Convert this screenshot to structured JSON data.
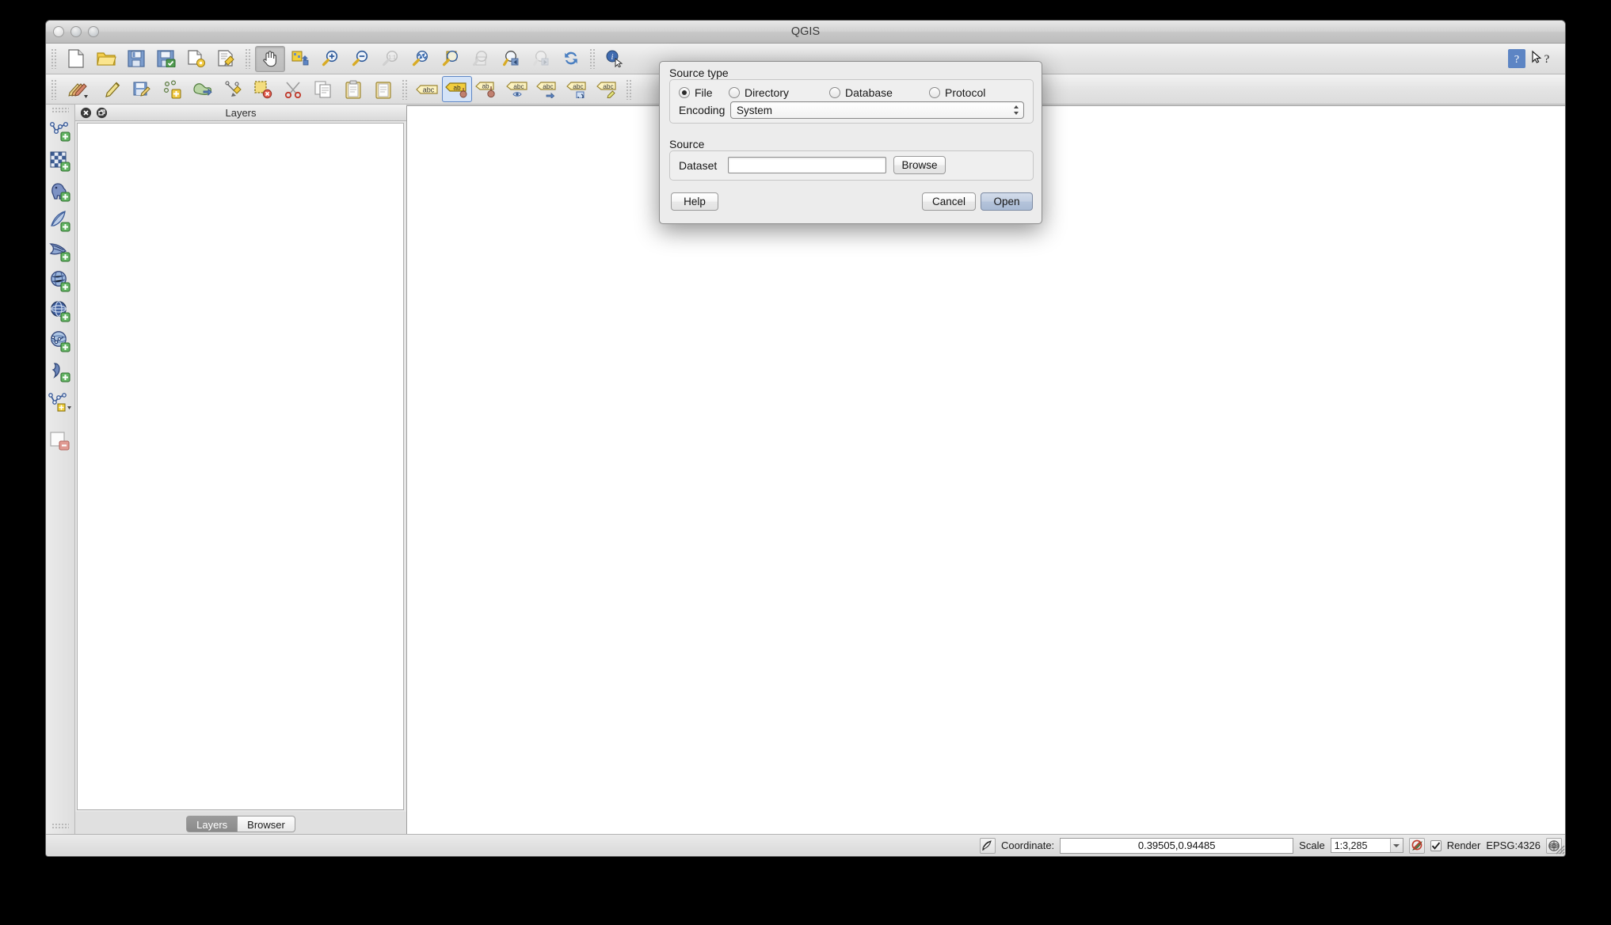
{
  "window": {
    "title": "QGIS",
    "controls": [
      "close-button",
      "minimize-button",
      "zoom-button"
    ]
  },
  "toolbar_file": {
    "icons": [
      {
        "name": "new-project-icon",
        "tip": "New Project"
      },
      {
        "name": "open-project-icon",
        "tip": "Open Project"
      },
      {
        "name": "save-project-icon",
        "tip": "Save Project"
      },
      {
        "name": "save-project-as-icon",
        "tip": "Save Project As"
      },
      {
        "name": "new-print-composer-icon",
        "tip": "New Print Composer"
      },
      {
        "name": "composer-manager-icon",
        "tip": "Composer Manager"
      }
    ]
  },
  "toolbar_navigation": {
    "icons": [
      {
        "name": "pan-map-icon",
        "tip": "Pan Map",
        "active": true
      },
      {
        "name": "pan-to-selection-icon",
        "tip": "Pan Map to Selection"
      },
      {
        "name": "zoom-in-icon",
        "tip": "Zoom In"
      },
      {
        "name": "zoom-out-icon",
        "tip": "Zoom Out"
      },
      {
        "name": "zoom-native-icon",
        "tip": "Zoom to Native Resolution",
        "disabled": true
      },
      {
        "name": "zoom-full-icon",
        "tip": "Zoom Full"
      },
      {
        "name": "zoom-to-selection-icon",
        "tip": "Zoom to Selection"
      },
      {
        "name": "zoom-to-layer-icon",
        "tip": "Zoom to Layer",
        "disabled": true
      },
      {
        "name": "zoom-last-icon",
        "tip": "Zoom Last"
      },
      {
        "name": "zoom-next-icon",
        "tip": "Zoom Next",
        "disabled": true
      },
      {
        "name": "refresh-icon",
        "tip": "Refresh"
      },
      {
        "name": "identify-features-icon",
        "tip": "Identify Features"
      }
    ]
  },
  "toolbar_help": {
    "icons": [
      {
        "name": "help-contents-icon",
        "tip": "Help Contents"
      },
      {
        "name": "whats-this-icon",
        "tip": "What's This?"
      }
    ]
  },
  "toolbar_digitizing": {
    "icons": [
      {
        "name": "current-edits-icon",
        "tip": "Current Edits"
      },
      {
        "name": "toggle-editing-icon",
        "tip": "Toggle Editing"
      },
      {
        "name": "save-layer-edits-icon",
        "tip": "Save Layer Edits"
      },
      {
        "name": "add-feature-icon",
        "tip": "Add Feature"
      },
      {
        "name": "move-feature-icon",
        "tip": "Move Feature"
      },
      {
        "name": "node-tool-icon",
        "tip": "Node Tool"
      },
      {
        "name": "delete-selected-icon",
        "tip": "Delete Selected"
      },
      {
        "name": "cut-features-icon",
        "tip": "Cut Features"
      },
      {
        "name": "copy-features-icon",
        "tip": "Copy Features"
      },
      {
        "name": "paste-features-icon",
        "tip": "Paste Features"
      }
    ]
  },
  "toolbar_label": {
    "icons": [
      {
        "name": "layer-labeling-options-icon",
        "tip": "Layer Labeling Options"
      },
      {
        "name": "highlight-pinned-labels-icon",
        "tip": "Highlight Pinned Labels",
        "selected": true
      },
      {
        "name": "pin-labels-icon",
        "tip": "Pin/Unpin Labels"
      },
      {
        "name": "show-hide-labels-icon",
        "tip": "Show/Hide Labels"
      },
      {
        "name": "move-label-icon",
        "tip": "Move Label"
      },
      {
        "name": "rotate-label-icon",
        "tip": "Rotate Label"
      },
      {
        "name": "change-label-icon",
        "tip": "Change Label"
      }
    ],
    "glyph": "abc"
  },
  "left_rail": {
    "items": [
      {
        "name": "add-vector-layer-icon",
        "tip": "Add Vector Layer"
      },
      {
        "name": "add-raster-layer-icon",
        "tip": "Add Raster Layer"
      },
      {
        "name": "add-postgis-layer-icon",
        "tip": "Add PostGIS Layer"
      },
      {
        "name": "add-spatialite-layer-icon",
        "tip": "Add SpatiaLite Layer"
      },
      {
        "name": "add-mssql-layer-icon",
        "tip": "Add MSSQL Spatial Layer"
      },
      {
        "name": "add-wcs-layer-icon",
        "tip": "Add WCS Layer"
      },
      {
        "name": "add-wms-layer-icon",
        "tip": "Add WMS/WMTS Layer"
      },
      {
        "name": "add-wfs-layer-icon",
        "tip": "Add WFS Layer"
      },
      {
        "name": "add-delimited-text-layer-icon",
        "tip": "Add Delimited Text Layer"
      },
      {
        "name": "new-shapefile-layer-icon",
        "tip": "New Shapefile Layer"
      },
      {
        "name": "remove-layer-icon",
        "tip": "Remove Layer"
      }
    ]
  },
  "layers_panel": {
    "title": "Layers",
    "close_icon": "close-panel-icon",
    "float_icon": "float-panel-icon",
    "items": [],
    "tabs": [
      {
        "label": "Layers",
        "selected": true
      },
      {
        "label": "Browser",
        "selected": false
      }
    ]
  },
  "statusbar": {
    "messages_icon": "messages-icon",
    "coordinate_label": "Coordinate:",
    "coordinate_value": "0.39505,0.94485",
    "scale_label": "Scale",
    "scale_value": "1:3,285",
    "magnifier_icon": "magnifier-disabled-icon",
    "render_label": "Render",
    "render_checked": true,
    "crs_label": "EPSG:4326",
    "crs_icon": "crs-globe-icon",
    "resize_grip": "resize-grip-icon"
  },
  "dialog": {
    "source_type": {
      "group_label": "Source type",
      "options": [
        {
          "label": "File",
          "selected": true
        },
        {
          "label": "Directory",
          "selected": false
        },
        {
          "label": "Database",
          "selected": false
        },
        {
          "label": "Protocol",
          "selected": false
        }
      ],
      "encoding_label": "Encoding",
      "encoding_value": "System"
    },
    "source": {
      "group_label": "Source",
      "dataset_label": "Dataset",
      "dataset_value": "",
      "dataset_placeholder": "",
      "browse_label": "Browse"
    },
    "buttons": {
      "help": "Help",
      "cancel": "Cancel",
      "open": "Open"
    }
  },
  "colors": {
    "accent": "#5d85c4",
    "default_button": "#aabbd4",
    "window_chrome": "#dcdcdc",
    "canvas": "#ffffff"
  }
}
